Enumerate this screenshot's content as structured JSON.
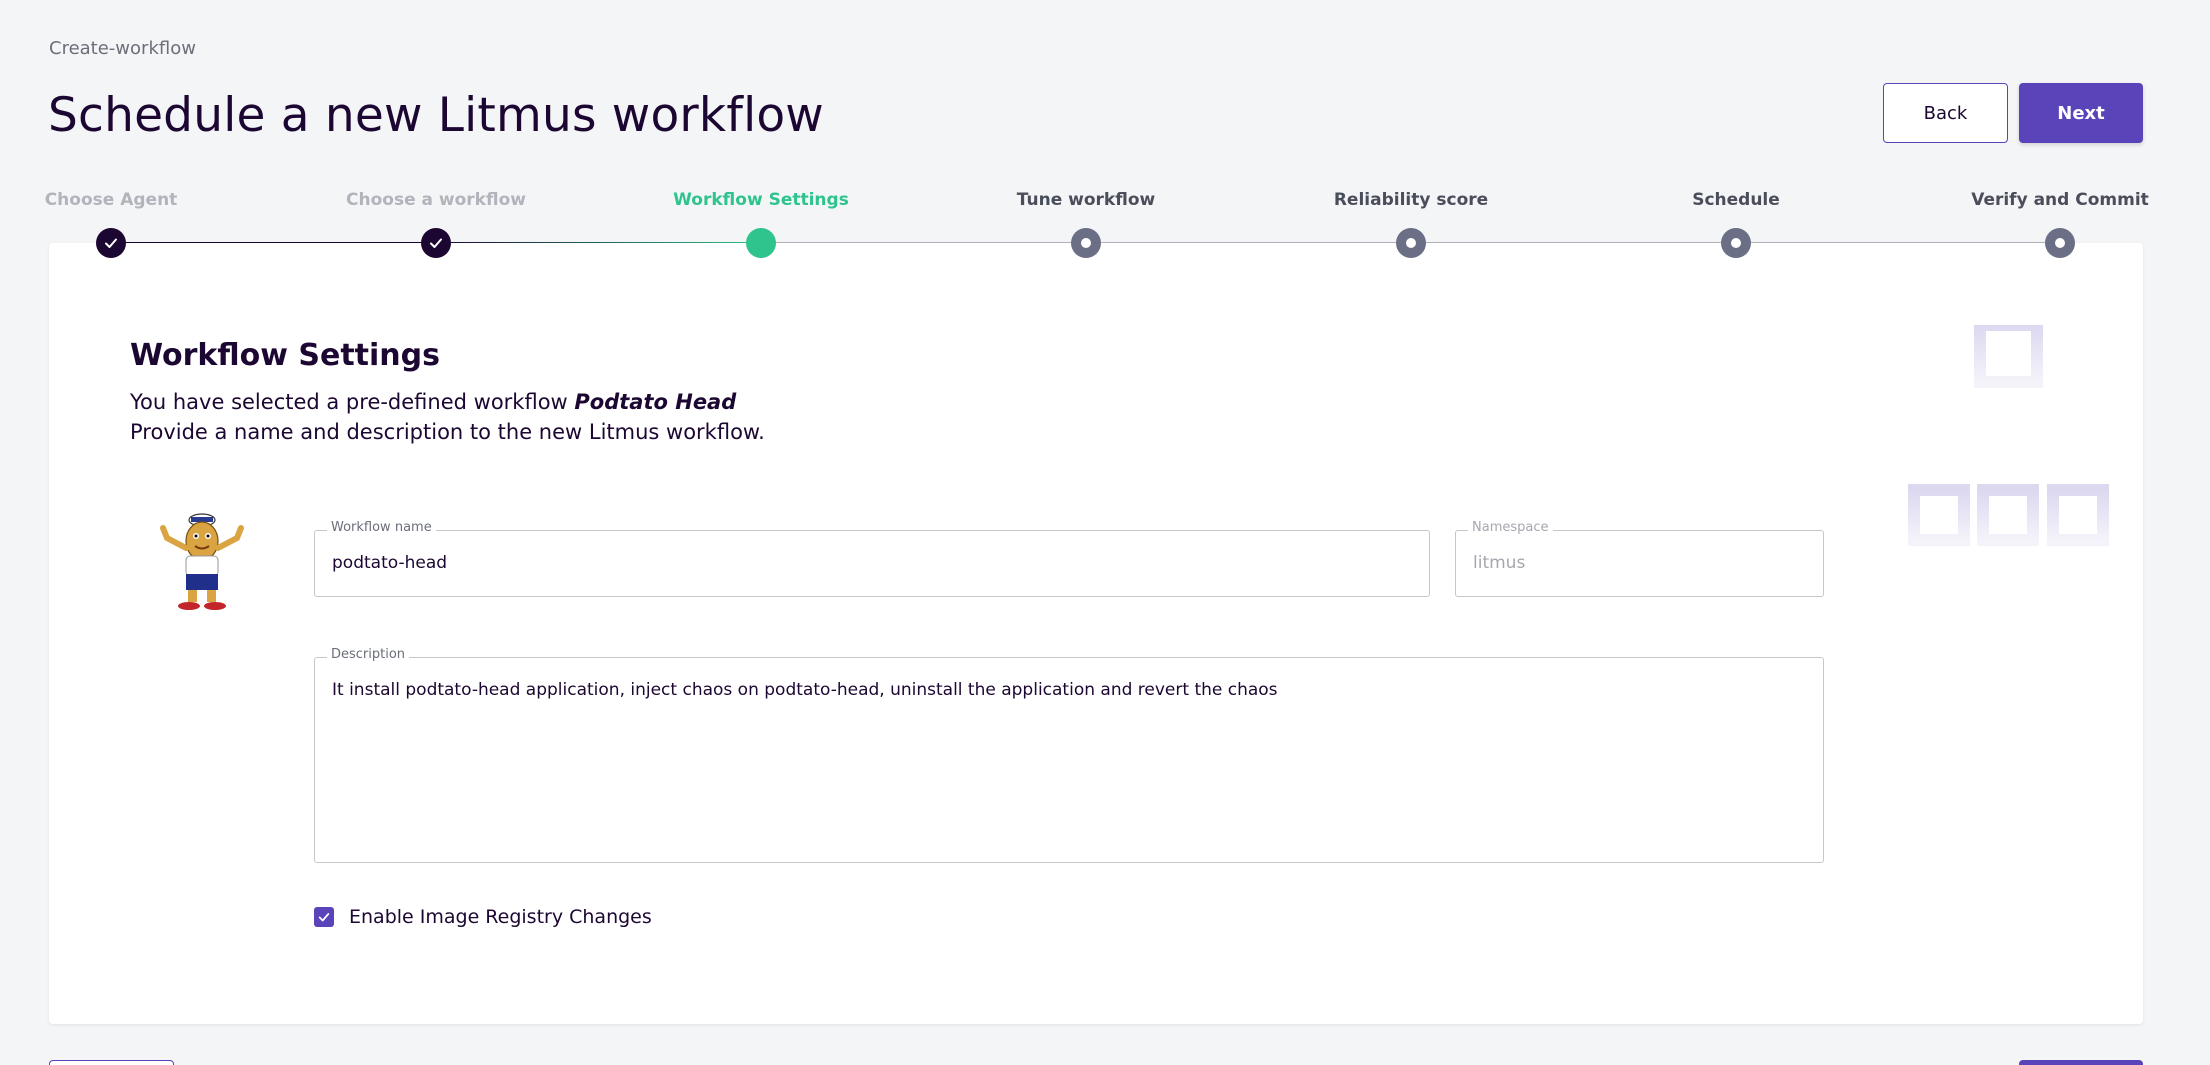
{
  "header": {
    "breadcrumb": "Create-workflow",
    "title": "Schedule a new Litmus workflow",
    "back_label": "Back",
    "next_label": "Next"
  },
  "stepper": {
    "steps": [
      {
        "label": "Choose Agent",
        "state": "done"
      },
      {
        "label": "Choose a workflow",
        "state": "done"
      },
      {
        "label": "Workflow Settings",
        "state": "active"
      },
      {
        "label": "Tune workflow",
        "state": "pending"
      },
      {
        "label": "Reliability score",
        "state": "pending"
      },
      {
        "label": "Schedule",
        "state": "pending"
      },
      {
        "label": "Verify and Commit",
        "state": "pending"
      }
    ]
  },
  "settings": {
    "title": "Workflow Settings",
    "intro_prefix": "You have selected a pre-defined workflow ",
    "workflow_name_highlight": "Podtato Head",
    "intro_line2": "Provide a name and description to the new Litmus workflow.",
    "fields": {
      "name_label": "Workflow name",
      "name_value": "podtato-head",
      "namespace_label": "Namespace",
      "namespace_value": "litmus",
      "description_label": "Description",
      "description_value": "It install podtato-head application, inject chaos on podtato-head, uninstall the application  and revert the chaos"
    },
    "checkbox_label": "Enable Image Registry Changes",
    "checkbox_checked": true
  },
  "colors": {
    "accent": "#5b44ba",
    "active_step": "#2fc48d",
    "dark": "#1c0732",
    "pending_step": "#6b6f86"
  },
  "icons": [
    "check-icon",
    "workflow-tree-icon",
    "mascot-image"
  ]
}
